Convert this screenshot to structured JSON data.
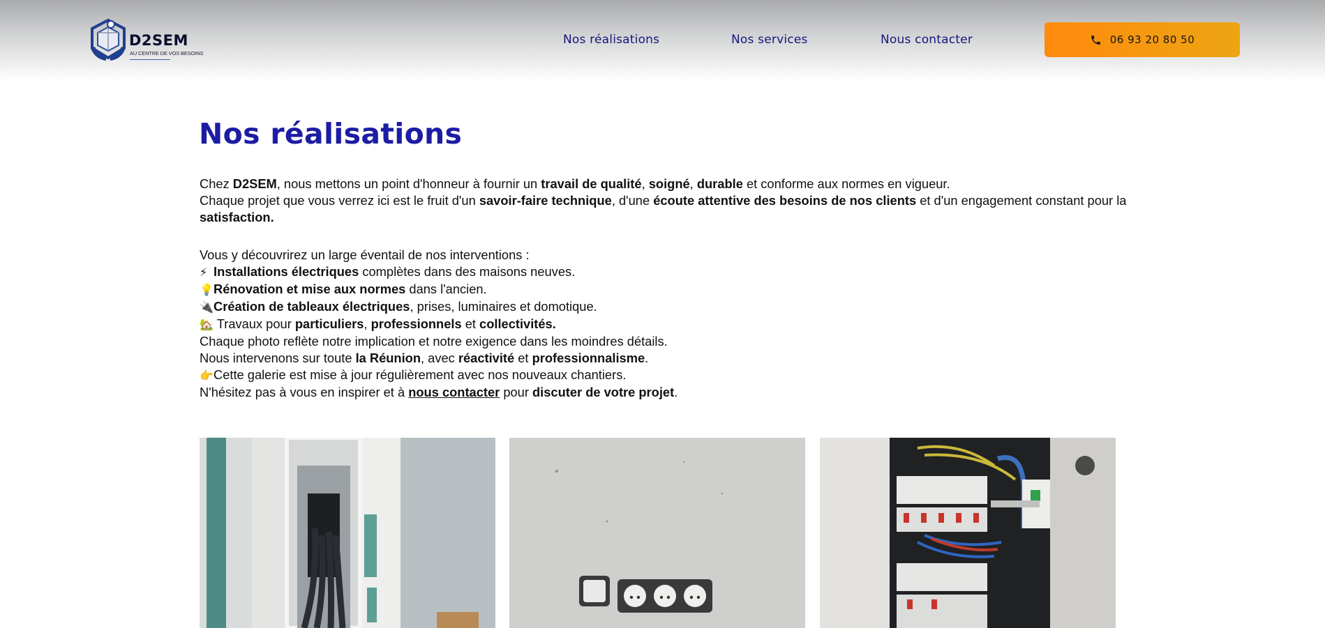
{
  "brand": {
    "name": "D2SEM",
    "tagline": "AU CENTRE DE VOS BESOINS",
    "primary_color": "#1c1ca4",
    "accent_color": "#ff8a0d"
  },
  "nav": {
    "items": [
      {
        "label": "Nos réalisations"
      },
      {
        "label": "Nos services"
      },
      {
        "label": "Nous contacter"
      }
    ],
    "cta": {
      "icon": "phone-icon",
      "label": "06 93 20 80 50"
    }
  },
  "main": {
    "title": "Nos réalisations",
    "intro": {
      "p1": {
        "a": "Chez ",
        "b": "D2SEM",
        "c": ", nous mettons un point d'honneur à fournir un ",
        "d": "travail de qualité",
        "e": ", ",
        "f": "soigné",
        "g": ", ",
        "h": "durable",
        "i": " et conforme aux normes en vigueur."
      },
      "p2": {
        "a": "Chaque projet que vous verrez ici est le fruit d'un ",
        "b": "savoir-faire technique",
        "c": ", d'une ",
        "d": "écoute attentive des besoins de nos clients",
        "e": " et d'un engagement constant pour la ",
        "f": "satisfaction."
      },
      "list_intro": "Vous y découvrirez un large éventail de nos interventions :",
      "items": [
        {
          "icon": "⚡",
          "bold": "Installations électriques",
          "rest": " complètes dans des maisons neuves."
        },
        {
          "icon": "💡",
          "bold": "Rénovation et mise aux normes",
          "rest": " dans l'ancien."
        },
        {
          "icon": "🔌",
          "bold": "Création de tableaux électriques",
          "rest": ", prises, luminaires et domotique."
        }
      ],
      "item4": {
        "icon": "🏡",
        "a": " Travaux pour ",
        "b": "particuliers",
        "c": ", ",
        "d": "professionnels",
        "e": " et ",
        "f": "collectivités."
      },
      "photo_line": "Chaque photo reflète notre implication et notre exigence dans les moindres détails.",
      "reunion": {
        "a": "Nous intervenons sur toute ",
        "b": "la Réunion",
        "c": ", avec ",
        "d": "réactivité",
        "e": " et ",
        "f": "professionnalisme",
        "g": "."
      },
      "gallery_line": {
        "icon": "👉",
        "text": "Cette galerie est mise à jour régulièrement avec nos nouveaux chantiers."
      },
      "closing": {
        "a": "N'hésitez pas à vous en inspirer et à ",
        "link": "nous contacter",
        "b": " pour ",
        "c": "discuter de votre projet",
        "d": "."
      }
    }
  },
  "gallery": {
    "photos": [
      {
        "subject": "electrical-panel-in-wall"
      },
      {
        "subject": "wall-sockets"
      },
      {
        "subject": "open-breaker-panel"
      }
    ]
  }
}
